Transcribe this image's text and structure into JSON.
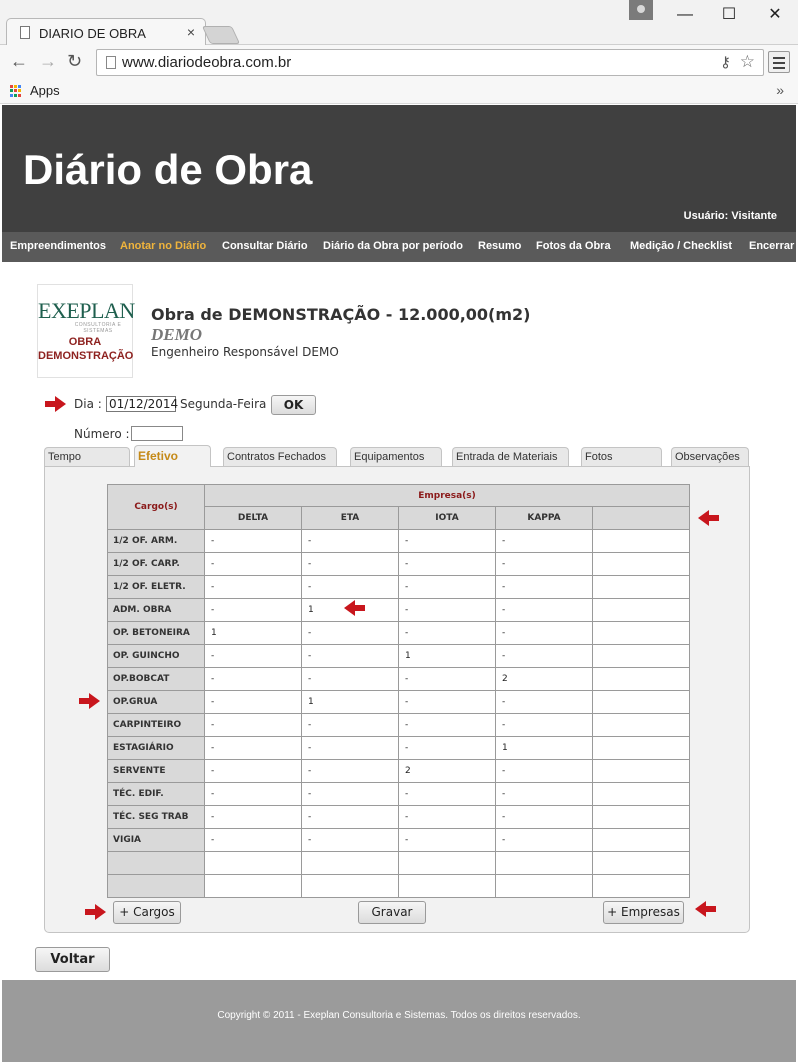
{
  "browser": {
    "tab_title": "DIARIO DE OBRA",
    "tab_close": "×",
    "url": "www.diariodeobra.com.br",
    "apps_label": "Apps",
    "bookmarks_more": "»",
    "window_controls": {
      "minimize": "—",
      "maximize": "☐",
      "close": "✕"
    },
    "nav_icons": {
      "back": "←",
      "forward": "→",
      "reload": "↻",
      "key": "⚷",
      "star": "☆"
    }
  },
  "header": {
    "site_title": "Diário de Obra",
    "user_label": "Usuário: Visitante"
  },
  "nav": {
    "items": [
      {
        "label": "Empreendimentos",
        "active": false
      },
      {
        "label": "Anotar no Diário",
        "active": true
      },
      {
        "label": "Consultar Diário",
        "active": false
      },
      {
        "label": "Diário da Obra por período",
        "active": false
      },
      {
        "label": "Resumo",
        "active": false
      },
      {
        "label": "Fotos da Obra",
        "active": false
      },
      {
        "label": "Medição / Checklist",
        "active": false
      },
      {
        "label": "Encerrar",
        "active": false
      }
    ],
    "active_color": "#f0b43c"
  },
  "logo": {
    "word": "EXEPLAN",
    "sub": "CONSULTORIA E SISTEMAS",
    "line1": "OBRA",
    "line2": "DEMONSTRAÇÃO"
  },
  "project": {
    "title": "Obra de DEMONSTRAÇÃO - 12.000,00(m2)",
    "code": "DEMO",
    "engineer": "Engenheiro Responsável DEMO"
  },
  "form": {
    "dia_label": "Dia :",
    "dia_value": "01/12/2014",
    "weekday": "Segunda-Feira",
    "ok_label": "OK",
    "numero_label": "Número :",
    "numero_value": ""
  },
  "tabs": [
    {
      "label": "Tempo",
      "active": false
    },
    {
      "label": "Efetivo",
      "active": true
    },
    {
      "label": "Contratos Fechados",
      "active": false
    },
    {
      "label": "Equipamentos",
      "active": false
    },
    {
      "label": "Entrada de Materiais",
      "active": false
    },
    {
      "label": "Fotos",
      "active": false
    },
    {
      "label": "Observações",
      "active": false
    }
  ],
  "efetivo": {
    "cargo_header": "Cargo(s)",
    "empresa_header": "Empresa(s)",
    "empresas": [
      "DELTA",
      "ETA",
      "IOTA",
      "KAPPA",
      ""
    ],
    "rows": [
      {
        "cargo": "1/2 OF. ARM.",
        "values": [
          "-",
          "-",
          "-",
          "-",
          ""
        ]
      },
      {
        "cargo": "1/2 OF. CARP.",
        "values": [
          "-",
          "-",
          "-",
          "-",
          ""
        ]
      },
      {
        "cargo": "1/2 OF. ELETR.",
        "values": [
          "-",
          "-",
          "-",
          "-",
          ""
        ]
      },
      {
        "cargo": "ADM. OBRA",
        "values": [
          "-",
          "1",
          "-",
          "-",
          ""
        ]
      },
      {
        "cargo": "OP. BETONEIRA",
        "values": [
          "1",
          "-",
          "-",
          "-",
          ""
        ]
      },
      {
        "cargo": "OP. GUINCHO",
        "values": [
          "-",
          "-",
          "1",
          "-",
          ""
        ]
      },
      {
        "cargo": "OP.BOBCAT",
        "values": [
          "-",
          "-",
          "-",
          "2",
          ""
        ]
      },
      {
        "cargo": "OP.GRUA",
        "values": [
          "-",
          "1",
          "-",
          "-",
          ""
        ]
      },
      {
        "cargo": "CARPINTEIRO",
        "values": [
          "-",
          "-",
          "-",
          "-",
          ""
        ]
      },
      {
        "cargo": "ESTAGIÁRIO",
        "values": [
          "-",
          "-",
          "-",
          "1",
          ""
        ]
      },
      {
        "cargo": "SERVENTE",
        "values": [
          "-",
          "-",
          "2",
          "-",
          ""
        ]
      },
      {
        "cargo": "TÉC. EDIF.",
        "values": [
          "-",
          "-",
          "-",
          "-",
          ""
        ]
      },
      {
        "cargo": "TÉC. SEG TRAB",
        "values": [
          "-",
          "-",
          "-",
          "-",
          ""
        ]
      },
      {
        "cargo": "VIGIA",
        "values": [
          "-",
          "-",
          "-",
          "-",
          ""
        ]
      },
      {
        "cargo": "",
        "values": [
          "",
          "",
          "",
          "",
          ""
        ]
      },
      {
        "cargo": "",
        "values": [
          "",
          "",
          "",
          "",
          ""
        ]
      }
    ],
    "add_cargos_label": "+ Cargos",
    "gravar_label": "Gravar",
    "add_empresas_label": "+ Empresas"
  },
  "voltar_label": "Voltar",
  "footer": {
    "copyright": "Copyright © 2011 - Exeplan Consultoria e Sistemas. Todos os direitos reservados."
  },
  "colors": {
    "header_bg": "#404040",
    "nav_bg": "#5a5a5a",
    "arrow_red": "#c8161d",
    "accent_gold": "#c58a18",
    "footer_bg": "#9b9b9b"
  }
}
